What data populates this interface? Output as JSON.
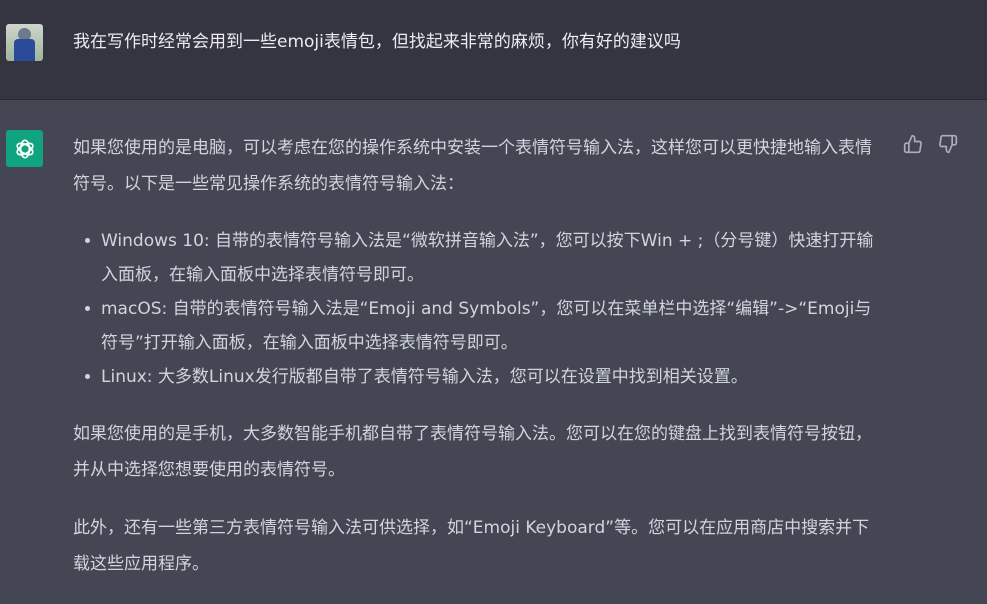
{
  "user_message": {
    "text": "我在写作时经常会用到一些emoji表情包，但找起来非常的麻烦，你有好的建议吗"
  },
  "assistant_message": {
    "paragraphs": [
      "如果您使用的是电脑，可以考虑在您的操作系统中安装一个表情符号输入法，这样您可以更快捷地输入表情符号。以下是一些常见操作系统的表情符号输入法：",
      "如果您使用的是手机，大多数智能手机都自带了表情符号输入法。您可以在您的键盘上找到表情符号按钮，并从中选择您想要使用的表情符号。",
      "此外，还有一些第三方表情符号输入法可供选择，如“Emoji Keyboard”等。您可以在应用商店中搜索并下载这些应用程序。"
    ],
    "bullets": [
      "Windows 10: 自带的表情符号输入法是“微软拼音输入法”，您可以按下Win + ;（分号键）快速打开输入面板，在输入面板中选择表情符号即可。",
      "macOS: 自带的表情符号输入法是“Emoji and Symbols”，您可以在菜单栏中选择“编辑”->“Emoji与符号”打开输入面板，在输入面板中选择表情符号即可。",
      "Linux: 大多数Linux发行版都自带了表情符号输入法，您可以在设置中找到相关设置。"
    ]
  },
  "icons": {
    "like": "thumbs-up-icon",
    "dislike": "thumbs-down-icon",
    "assistant_logo": "openai-logo-icon"
  },
  "colors": {
    "user_bg": "#343541",
    "assistant_bg": "#444654",
    "logo_bg": "#10a37f"
  }
}
